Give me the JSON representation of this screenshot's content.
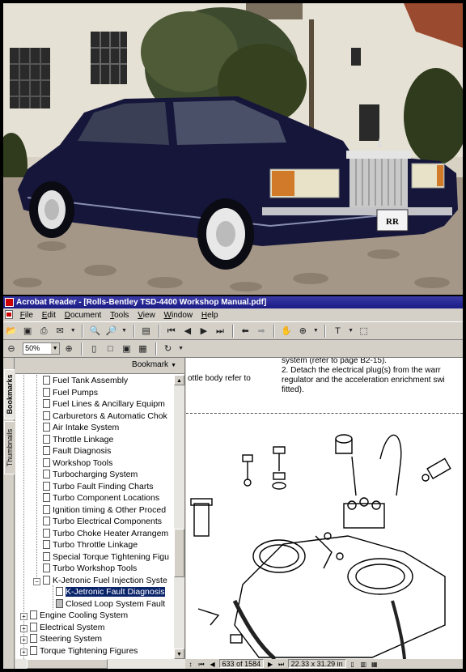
{
  "window": {
    "title": "Acrobat Reader - [Rolls-Bentley TSD-4400 Workshop Manual.pdf]"
  },
  "menu": [
    "File",
    "Edit",
    "Document",
    "Tools",
    "View",
    "Window",
    "Help"
  ],
  "zoom": {
    "value": "50%"
  },
  "tabs": {
    "bookmarks": "Bookmarks",
    "thumbnails": "Thumbnails"
  },
  "bookmarks_header": {
    "label": "Bookmark"
  },
  "tree": [
    {
      "label": "Fuel Tank Assembly"
    },
    {
      "label": "Fuel Pumps"
    },
    {
      "label": "Fuel Lines & Ancillary Equipm"
    },
    {
      "label": "Carburetors & Automatic Chok"
    },
    {
      "label": "Air Intake System"
    },
    {
      "label": "Throttle Linkage"
    },
    {
      "label": "Fault Diagnosis"
    },
    {
      "label": "Workshop Tools"
    },
    {
      "label": "Turbocharging System"
    },
    {
      "label": "Turbo Fault Finding Charts"
    },
    {
      "label": "Turbo Component Locations"
    },
    {
      "label": "Ignition timing & Other Proced"
    },
    {
      "label": "Turbo Electrical Components"
    },
    {
      "label": "Turbo Choke Heater Arrangem"
    },
    {
      "label": "Turbo Throttle Linkage"
    },
    {
      "label": "Special Torque Tightening Figu"
    },
    {
      "label": "Turbo Workshop Tools"
    },
    {
      "label": "K-Jetronic Fuel Injection Syste"
    },
    {
      "label": "K-Jetronic Fault Diagnosis"
    },
    {
      "label": "Closed Loop System Fault"
    },
    {
      "label": "Engine Cooling System"
    },
    {
      "label": "Electrical System"
    },
    {
      "label": "Steering System"
    },
    {
      "label": "Torque Tightening Figures"
    }
  ],
  "document": {
    "line1": "system (refer to page B2-15).",
    "line2": "2.    Detach the electrical plug(s) from the warr",
    "line3": "regulator and the acceleration enrichment swi",
    "line4": "fitted).",
    "left_snippet": "ottle body refer to"
  },
  "status": {
    "page": "633 of 1584",
    "size": "22.33 x 31.29 in"
  },
  "photo": {
    "plate": "RR"
  }
}
